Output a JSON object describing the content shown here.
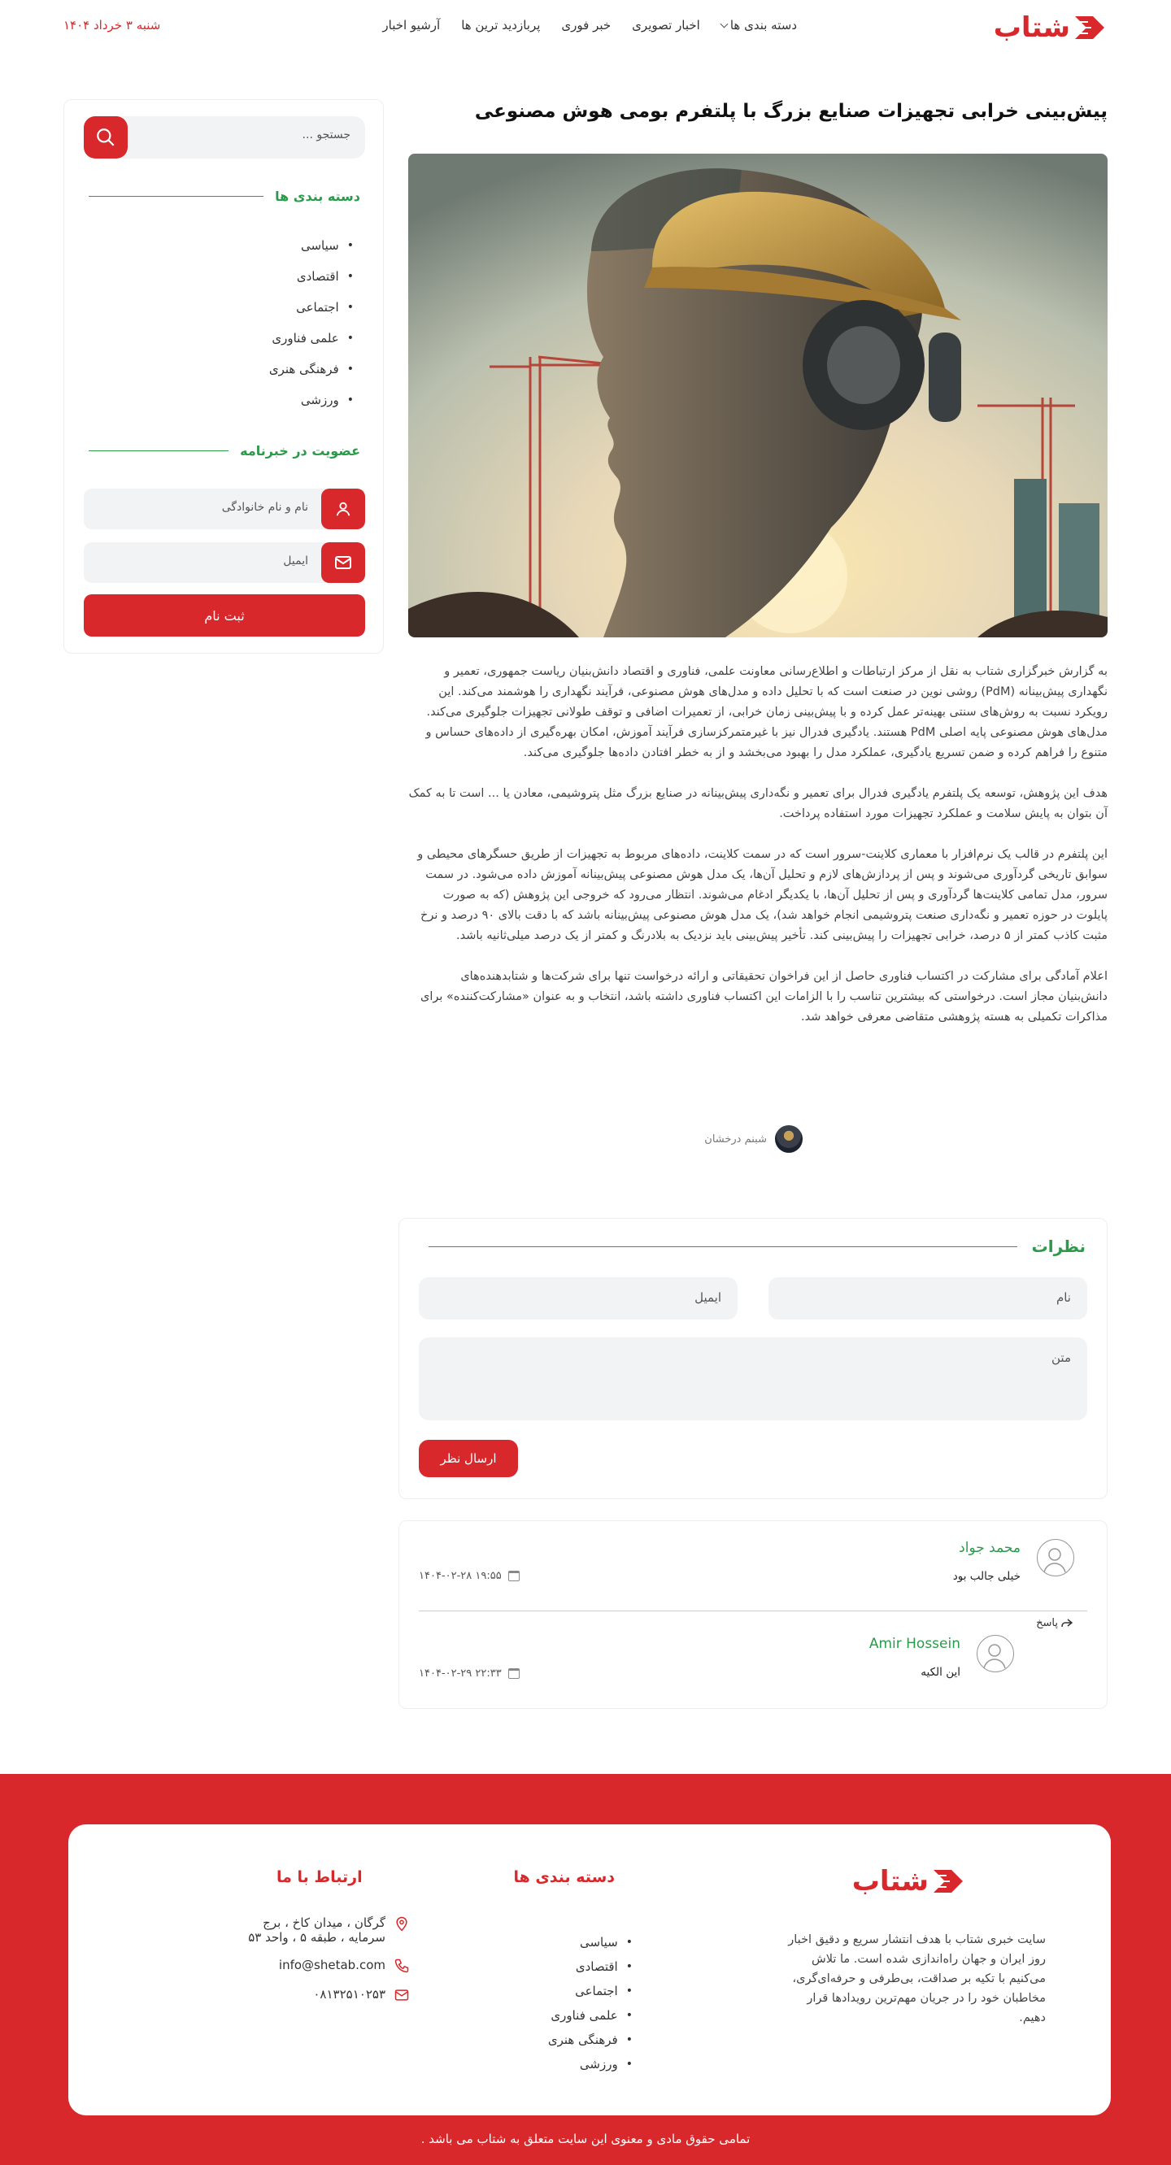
{
  "header": {
    "logo_text": "شتاب",
    "nav": [
      {
        "label": "دسته بندی ها",
        "has_dropdown": true
      },
      {
        "label": "اخبار تصویری"
      },
      {
        "label": "خبر فوری"
      },
      {
        "label": "پربازدید ترین ها"
      },
      {
        "label": "آرشیو اخبار"
      }
    ],
    "date": "شنبه ۳ خرداد ۱۴۰۴"
  },
  "article": {
    "title": "پیش‌بینی خرابی تجهیزات صنایع بزرگ با پلتفرم بومی هوش مصنوعی",
    "image_alt": "worker-head-ai-art",
    "paragraphs": [
      "به گزارش خبرگزاری شتاب به نقل از مرکز ارتباطات و اطلاع‌رسانی معاونت علمی، فناوری و اقتصاد دانش‌بنیان ریاست جمهوری، تعمیر و نگهداری پیش‌بینانه (PdM) روشی نوین در صنعت است که با تحلیل داده و مدل‌های هوش مصنوعی، فرآیند نگهداری را هوشمند می‌کند. این رویکرد نسبت به روش‌های سنتی بهینه‌تر عمل کرده و با پیش‌بینی زمان خرابی، از تعمیرات اضافی و توقف طولانی تجهیزات جلوگیری می‌کند. مدل‌های هوش مصنوعی پایه اصلی PdM هستند. یادگیری فدرال نیز با غیرمتمرکزسازی فرآیند آموزش، امکان بهره‌گیری از داده‌های حساس و متنوع را فراهم کرده و ضمن تسریع یادگیری، عملکرد مدل را بهبود می‌بخشد و از به خطر افتادن داده‌ها جلوگیری می‌کند.",
      "هدف این پژوهش، توسعه یک پلتفرم یادگیری فدرال برای تعمیر و نگه‌داری پیش‌بینانه در صنایع بزرگ مثل پتروشیمی، معادن یا ... است تا به کمک آن بتوان به پایش سلامت و عملکرد تجهیزات مورد استفاده پرداخت.",
      "این پلتفرم در قالب یک نرم‌افزار با معماری کلاینت-سرور است که در سمت کلاینت، داده‌های مربوط به تجهیزات از طریق حسگرهای محیطی و سوابق تاریخی گردآوری می‌شوند و پس از پردازش‌های لازم و تحلیل آن‌ها، یک مدل هوش مصنوعی پیش‌بینانه آموزش داده می‌شود. در سمت سرور، مدل تمامی کلاینت‌ها گردآوری و پس از تحلیل آن‌ها، با یکدیگر ادغام می‌شوند. انتظار می‌رود که خروجی این پژوهش (که به صورت پایلوت در حوزه تعمیر و نگه‌داری صنعت پتروشیمی انجام خواهد شد)، یک مدل هوش مصنوعی پیش‌بینانه باشد که با دقت بالای ۹۰ درصد و نرخ مثبت کاذب کمتر از ۵ درصد، خرابی تجهیزات را پیش‌بینی کند. تأخیر پیش‌بینی باید نزدیک به بلادرنگ و کمتر از یک درصد میلی‌ثانیه باشد.",
      "اعلام آمادگی برای مشارکت در اکتساب فناوری حاصل از این فراخوان تحقیقاتی و ارائه درخواست تنها برای شرکت‌ها و شتابدهنده‌های دانش‌بنیان مجاز است. درخواستی که بیشترین تناسب را با الزامات این اکتساب فناوری داشته باشد، انتخاب و به عنوان «مشارکت‌کننده» برای مذاکرات تکمیلی به هسته پژوهشی متقاضی معرفی خواهد شد."
    ],
    "author": "شبنم درخشان"
  },
  "sidebar": {
    "search_placeholder": "جستجو ...",
    "categories_title": "دسته بندی ها",
    "categories": [
      "سیاسی",
      "اقتصادی",
      "اجتماعی",
      "علمی فناوری",
      "فرهنگی هنری",
      "ورزشی"
    ],
    "newsletter_title": "عضویت در خبرنامه",
    "name_placeholder": "نام و نام خانوادگی",
    "email_placeholder": "ایمیل",
    "submit_label": "ثبت نام"
  },
  "comment_form": {
    "title": "نظرات",
    "name_placeholder": "نام",
    "email_placeholder": "ایمیل",
    "text_placeholder": "متن",
    "send_label": "ارسال نظر"
  },
  "comments": [
    {
      "name": "محمد جواد",
      "text": "خیلی جالب بود",
      "date": "۱۴۰۴-۰۲-۲۸ ۱۹:۵۵"
    },
    {
      "name": "Amir Hossein",
      "text": "این الکیه",
      "date": "۱۴۰۴-۰۲-۲۹ ۲۲:۳۳",
      "is_reply": true
    }
  ],
  "reply_label": "پاسخ",
  "footer": {
    "logo_text": "شتاب",
    "about": "سایت خبری شتاب با هدف انتشار سریع و دقیق اخبار روز ایران و جهان راه‌اندازی شده است. ما تلاش می‌کنیم با تکیه بر صداقت، بی‌طرفی و حرفه‌ای‌گری، مخاطبان خود را در جریان مهم‌ترین رویدادها قرار دهیم.",
    "categories_title": "دسته بندی ها",
    "categories": [
      "سیاسی",
      "اقتصادی",
      "اجتماعی",
      "علمی فناوری",
      "فرهنگی هنری",
      "ورزشی"
    ],
    "contact_title": "ارتباط با ما",
    "address": "گرگان ، میدان کاخ ، برج سرمایه ، طبقه ۵ ، واحد ۵۳",
    "email": "info@shetab.com",
    "phone": "۰۸۱۳۲۵۱۰۲۵۳",
    "copyright": "تمامی حقوق مادی و معنوی این سایت متعلق به شتاب می باشد ."
  },
  "colors": {
    "brand_red": "#d8282b",
    "accent_green": "#2c9a4a"
  }
}
